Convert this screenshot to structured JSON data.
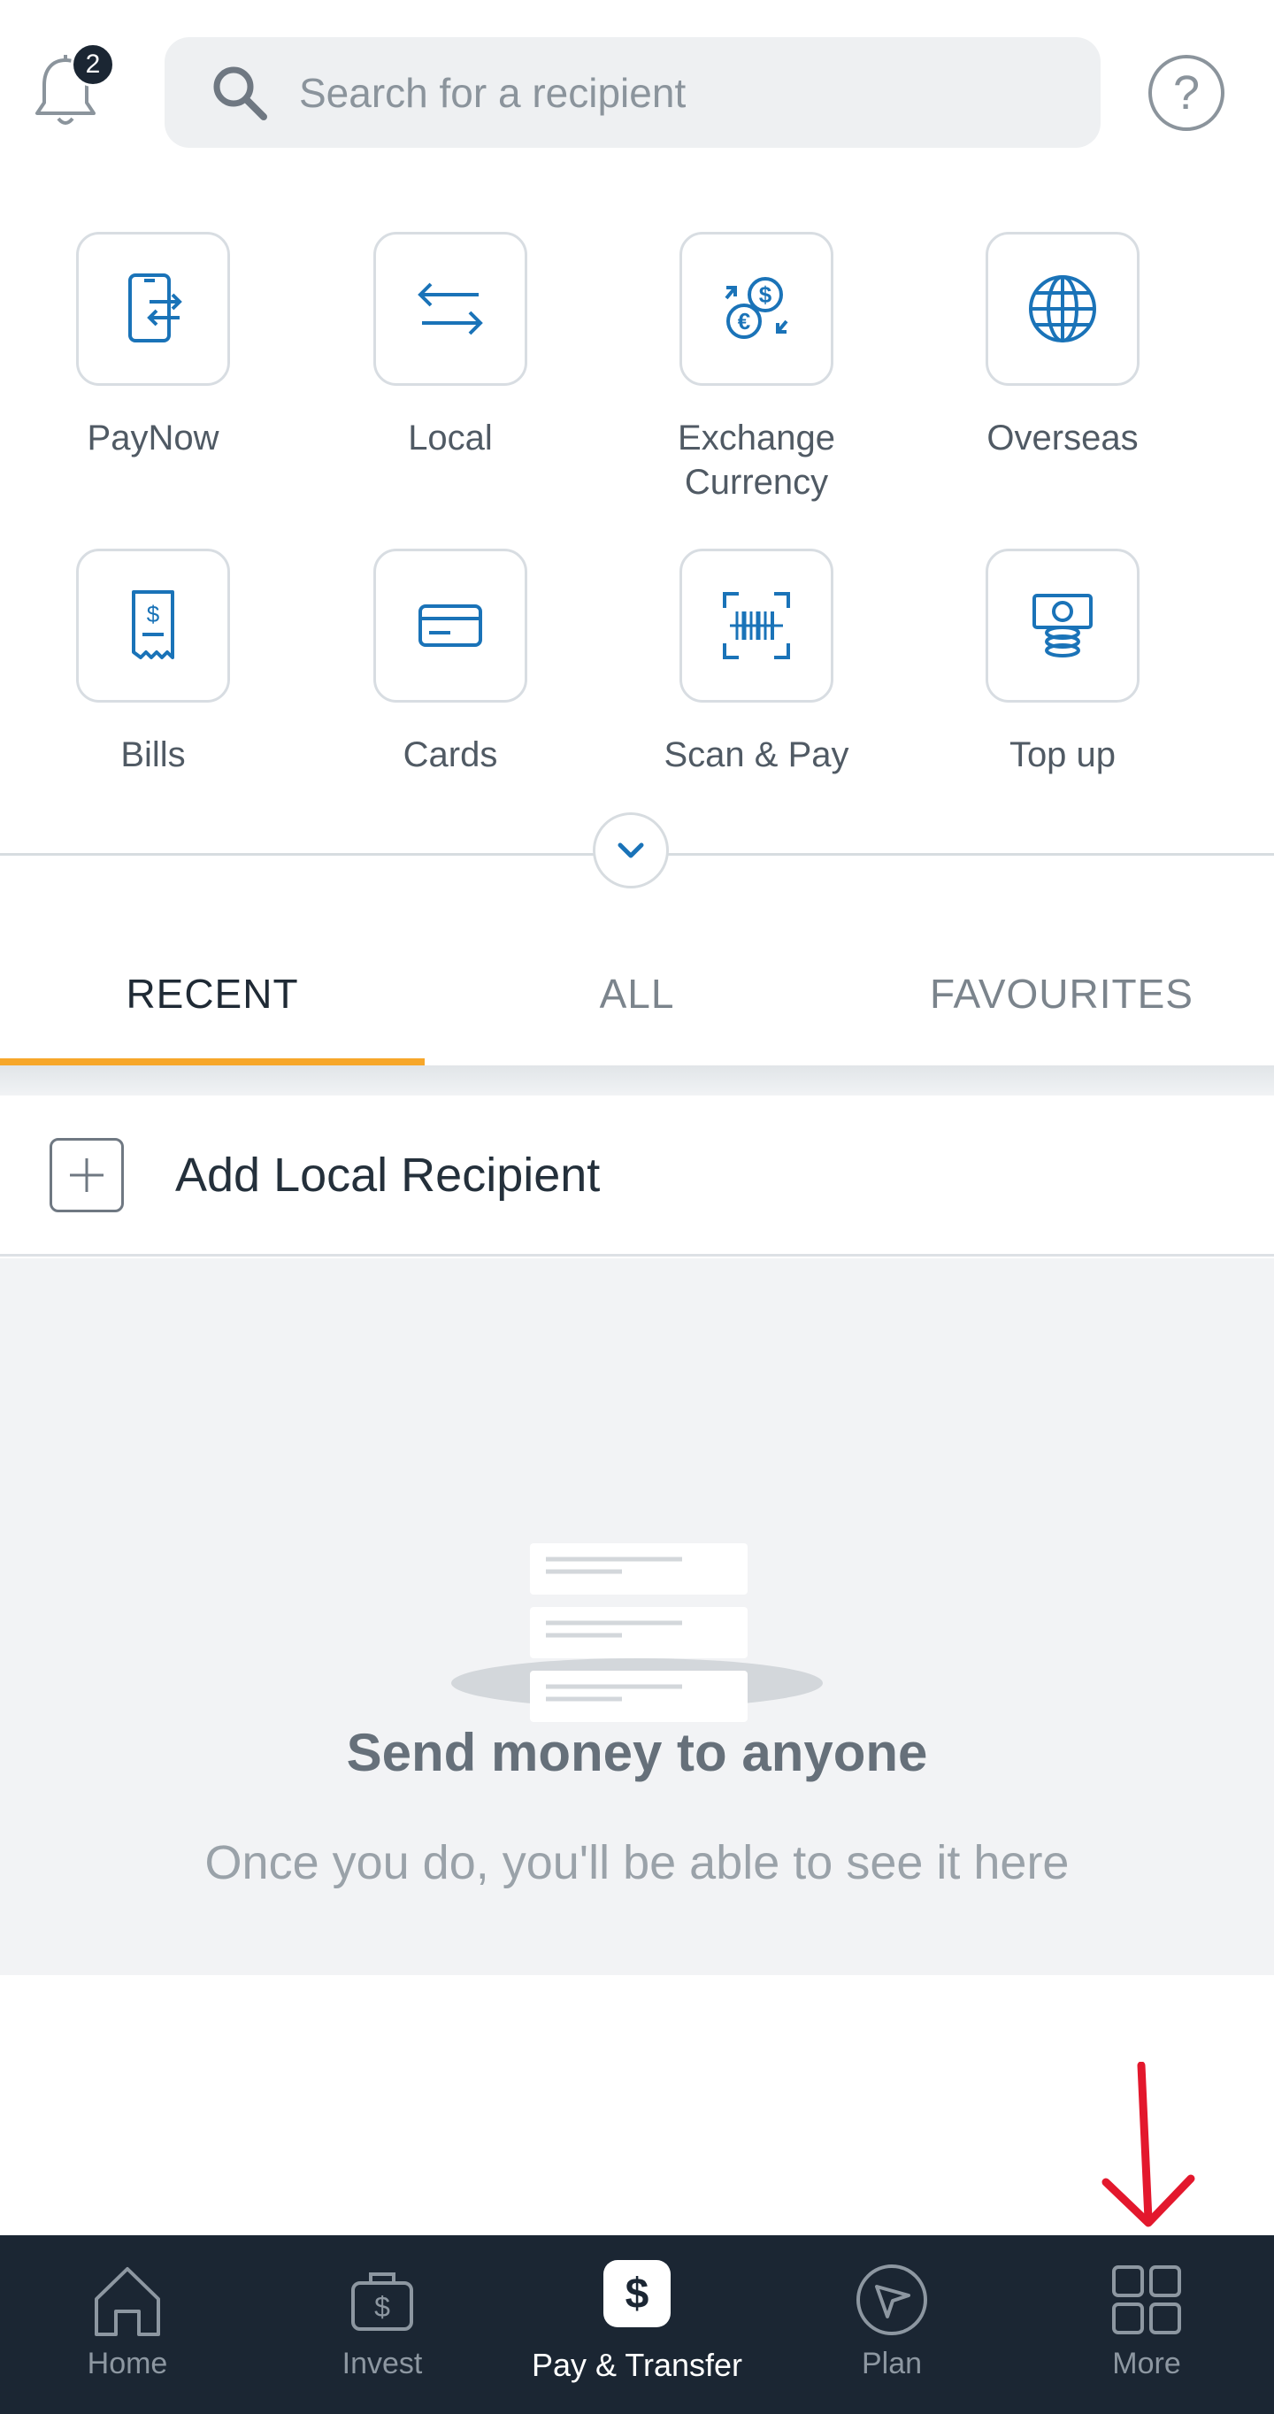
{
  "header": {
    "notification_count": "2",
    "search_placeholder": "Search for a recipient",
    "help_glyph": "?"
  },
  "quick_actions": [
    {
      "label": "PayNow",
      "icon": "paynow-icon"
    },
    {
      "label": "Local",
      "icon": "local-transfer-icon"
    },
    {
      "label": "Exchange\nCurrency",
      "icon": "exchange-currency-icon"
    },
    {
      "label": "Overseas",
      "icon": "globe-icon"
    },
    {
      "label": "Bills",
      "icon": "bill-receipt-icon"
    },
    {
      "label": "Cards",
      "icon": "card-icon"
    },
    {
      "label": "Scan & Pay",
      "icon": "barcode-scan-icon"
    },
    {
      "label": "Top up",
      "icon": "topup-money-icon"
    }
  ],
  "tabs": [
    {
      "label": "RECENT",
      "active": true
    },
    {
      "label": "ALL",
      "active": false
    },
    {
      "label": "FAVOURITES",
      "active": false
    }
  ],
  "add_recipient": {
    "label": "Add Local Recipient"
  },
  "empty_state": {
    "title": "Send money to anyone",
    "subtitle": "Once you do, you'll be able to see it here"
  },
  "bottom_nav": [
    {
      "label": "Home",
      "icon": "home-icon",
      "active": false
    },
    {
      "label": "Invest",
      "icon": "invest-bag-icon",
      "active": false
    },
    {
      "label": "Pay & Transfer",
      "icon": "dollar-icon",
      "active": true
    },
    {
      "label": "Plan",
      "icon": "plan-navigation-icon",
      "active": false
    },
    {
      "label": "More",
      "icon": "grid-more-icon",
      "active": false
    }
  ],
  "colors": {
    "accent_blue": "#1a73b8",
    "tab_underline": "#f7a72a",
    "nav_background": "#1b2633",
    "annotation_red": "#e3182d"
  }
}
